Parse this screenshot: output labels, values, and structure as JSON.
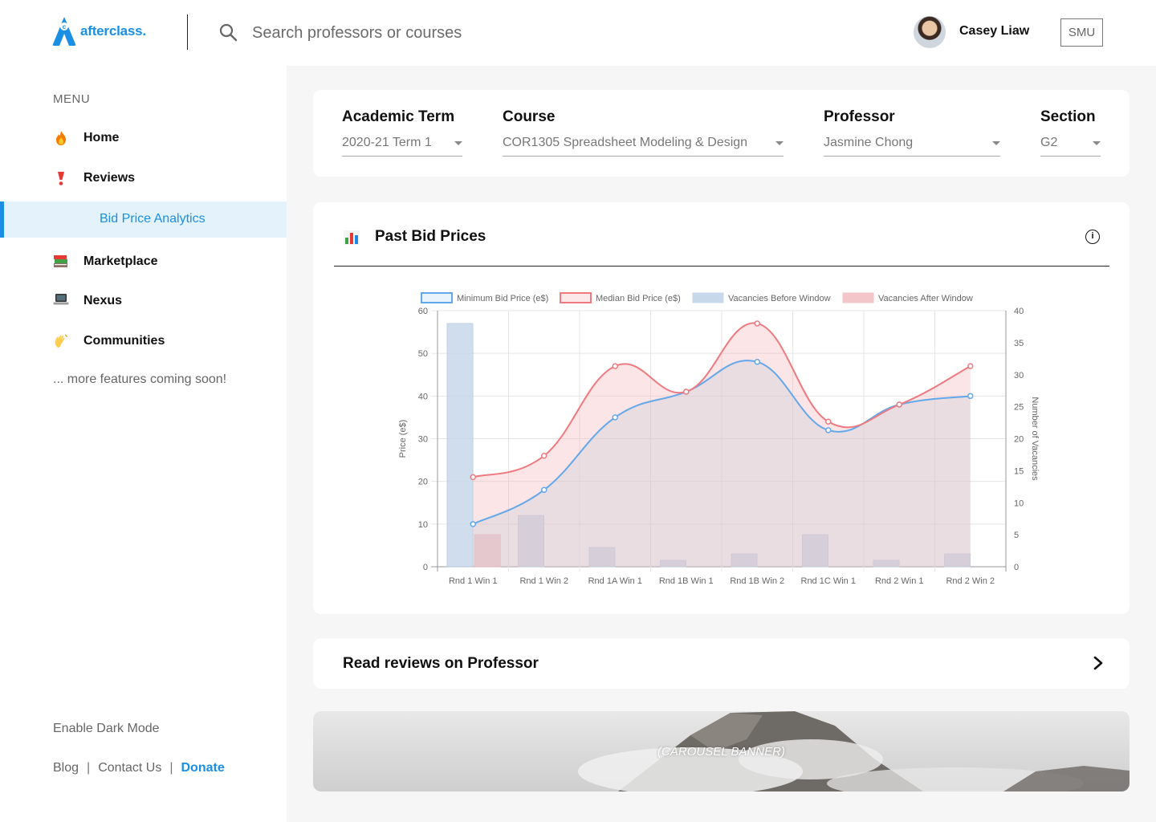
{
  "header": {
    "logo_text": "afterclass.",
    "search_placeholder": "Search professors or courses",
    "user_name": "Casey Liaw",
    "school": "SMU"
  },
  "sidebar": {
    "menu_title": "MENU",
    "items": [
      {
        "label": "Home",
        "icon": "fire-icon"
      },
      {
        "label": "Reviews",
        "icon": "exclamation-icon"
      },
      {
        "label": "Bid Price Analytics",
        "icon": "",
        "active": true
      },
      {
        "label": "Marketplace",
        "icon": "books-icon"
      },
      {
        "label": "Nexus",
        "icon": "laptop-icon"
      },
      {
        "label": "Communities",
        "icon": "waving-hand-icon"
      }
    ],
    "coming_soon": "... more features coming soon!",
    "dark_mode": "Enable Dark Mode",
    "footer": {
      "blog": "Blog",
      "contact": "Contact Us",
      "donate": "Donate"
    }
  },
  "filters": {
    "term": {
      "label": "Academic Term",
      "value": "2020-21 Term 1"
    },
    "course": {
      "label": "Course",
      "value": "COR1305 Spreadsheet Modeling & Design"
    },
    "professor": {
      "label": "Professor",
      "value": "Jasmine Chong"
    },
    "section": {
      "label": "Section",
      "value": "G2"
    }
  },
  "chart_card": {
    "title": "Past Bid Prices"
  },
  "reviews_card": {
    "label": "Read reviews on Professor"
  },
  "banner": {
    "label": "(CAROUSEL BANNER)"
  },
  "colors": {
    "accent": "#1a8fe3",
    "min_line": "#62a8ea",
    "median_line": "#ee7a80"
  },
  "chart_data": {
    "type": "line",
    "categories": [
      "Rnd 1 Win 1",
      "Rnd 1 Win 2",
      "Rnd 1A Win 1",
      "Rnd 1B Win 1",
      "Rnd 1B Win 2",
      "Rnd 1C Win 1",
      "Rnd 2 Win 1",
      "Rnd 2 Win 2"
    ],
    "ylabel": "Price (e$)",
    "y2label": "Number of Vacancies",
    "ylim": [
      0,
      60
    ],
    "y2lim": [
      0,
      40
    ],
    "yticks": [
      "0",
      "10",
      "20",
      "30",
      "40",
      "50",
      "60"
    ],
    "y2ticks": [
      "0",
      "5",
      "10",
      "15",
      "20",
      "25",
      "30",
      "35",
      "40"
    ],
    "legend_position": "top",
    "grid": true,
    "series": [
      {
        "name": "Minimum Bid Price (e$)",
        "type": "line",
        "axis": "left",
        "color": "#62a8ea",
        "values": [
          10,
          18,
          35,
          41,
          48,
          32,
          38,
          40
        ]
      },
      {
        "name": "Median Bid Price (e$)",
        "type": "line",
        "axis": "left",
        "color": "#ee7a80",
        "values": [
          21,
          26,
          47,
          41,
          57,
          34,
          38,
          47
        ]
      },
      {
        "name": "Vacancies Before Window",
        "type": "bar",
        "axis": "right",
        "color": "#c7d8ea",
        "values": [
          38,
          8,
          3,
          1,
          2,
          5,
          1,
          2
        ]
      },
      {
        "name": "Vacancies After Window",
        "type": "bar",
        "axis": "right",
        "color": "#f3c6c9",
        "values": [
          5,
          0,
          0,
          0,
          0,
          0,
          0,
          0
        ]
      }
    ]
  }
}
